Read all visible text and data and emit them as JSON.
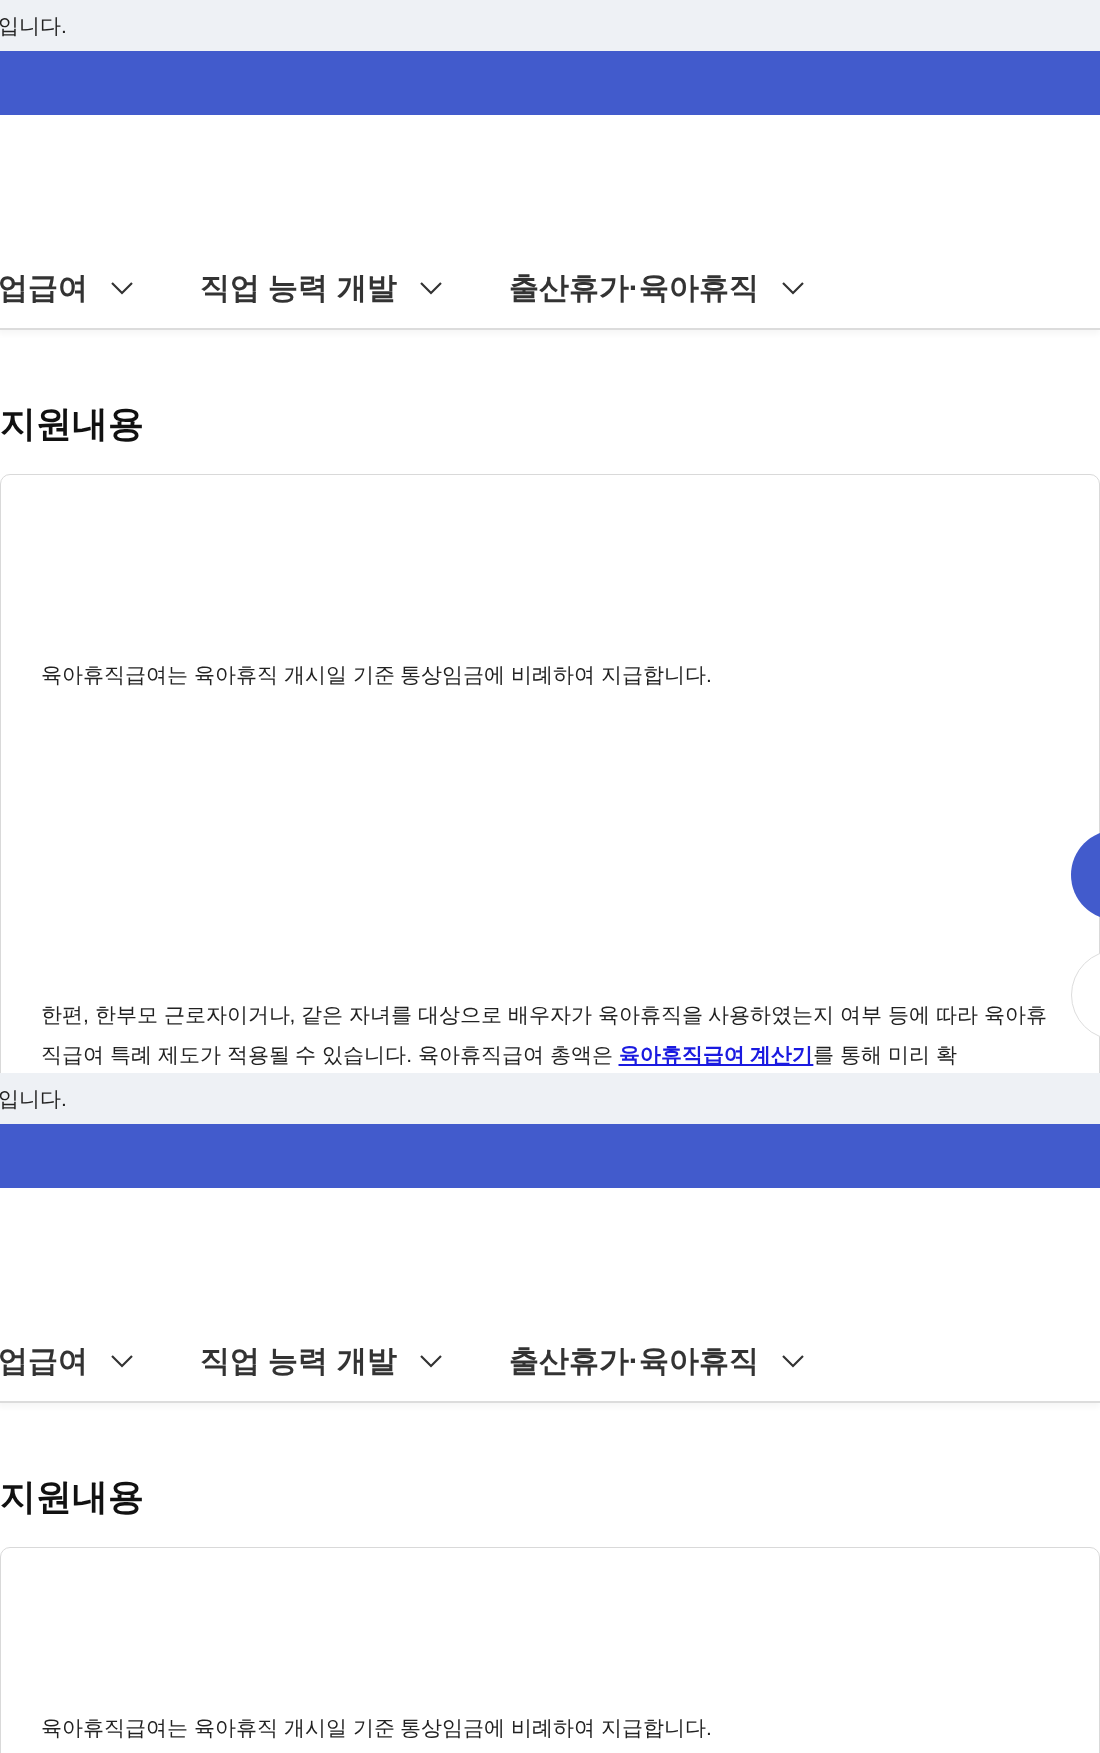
{
  "screens": [
    {
      "notice": "입니다.",
      "nav": [
        {
          "label": "업급여"
        },
        {
          "label": "직업 능력 개발"
        },
        {
          "label": "출산휴가·육아휴직"
        }
      ],
      "heading": "지원내용",
      "paragraphs": [
        {
          "before": "육아휴직급여는 육아휴직 개시일 기준 통상임금에 비례하여 지급합니다."
        },
        {
          "before": "한편, 한부모 근로자이거나, 같은 자녀를 대상으로 배우자가 육아휴직을 사용하였는지 여부 등에 따라 육아휴직급여 특례 제도가 적용될 수 있습니다. 육아휴직급여 총액은 ",
          "link": "육아휴직급여 계산기",
          "after": "를 통해 미리 확"
        }
      ],
      "floating_buttons": [
        {
          "kind": "primary"
        },
        {
          "kind": "secondary"
        }
      ]
    },
    {
      "notice": "입니다.",
      "nav": [
        {
          "label": "업급여"
        },
        {
          "label": "직업 능력 개발"
        },
        {
          "label": "출산휴가·육아휴직"
        }
      ],
      "heading": "지원내용",
      "paragraphs": [
        {
          "before": "육아휴직급여는 육아휴직 개시일 기준 통상임금에 비례하여 지급합니다."
        }
      ]
    }
  ]
}
